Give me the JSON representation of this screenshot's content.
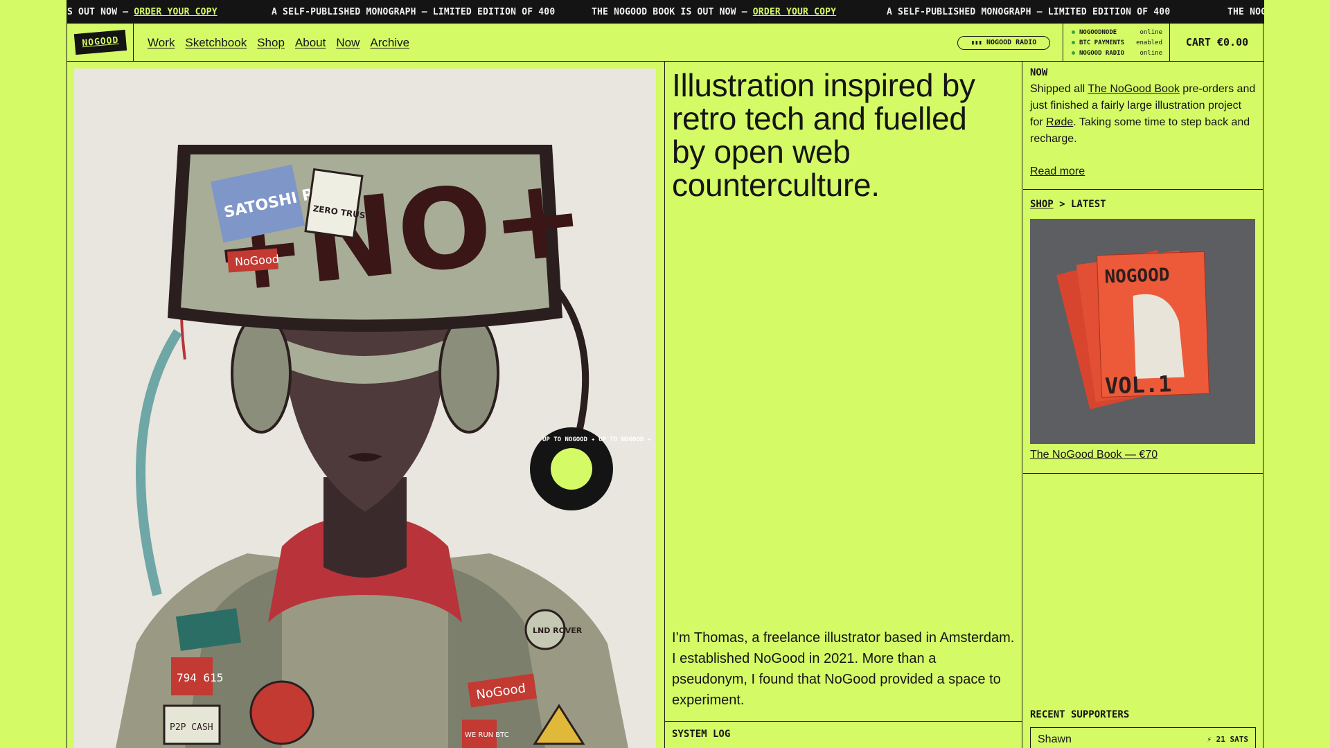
{
  "ticker": {
    "items": [
      {
        "text": "S OUT NOW — ",
        "link": "ORDER YOUR COPY"
      },
      {
        "text": "A SELF-PUBLISHED MONOGRAPH — LIMITED EDITION OF 400",
        "link": ""
      },
      {
        "text": "THE NOGOOD BOOK IS OUT NOW — ",
        "link": "ORDER YOUR COPY"
      },
      {
        "text": "A SELF-PUBLISHED MONOGRAPH — LIMITED EDITION OF 400",
        "link": ""
      },
      {
        "text": "THE NOG",
        "link": ""
      }
    ]
  },
  "header": {
    "logo": "NOGOOD",
    "nav": [
      "Work",
      "Sketchbook",
      "Shop",
      "About",
      "Now",
      "Archive"
    ],
    "radio_button": "NOGOOD RADIO",
    "status": [
      {
        "name": "NOGOODNODE",
        "state": "online"
      },
      {
        "name": "BTC PAYMENTS",
        "state": "enabled"
      },
      {
        "name": "NOGOOD RADIO",
        "state": "online"
      }
    ],
    "cart": "CART €0.00"
  },
  "hero": {
    "stickers": {
      "satoshi": "SATOSHI RADIO",
      "zero_trust": "ZERO TRUST",
      "nogood_small": "NoGood",
      "badge_ring": "UP TO NOGOOD ✦ UP TO NOGOOD ✦",
      "numbers": "794 615",
      "lnd": "LND ROVER",
      "p2p": "P2P CASH",
      "nogood_chest": "NoGood",
      "we_run": "WE RUN BTC"
    }
  },
  "main": {
    "headline": "Illustration inspired by retro tech and fuelled by open web counterculture.",
    "bio": "I’m Thomas, a freelance illustrator based in Amsterdam. I established NoGood in 2021. More than a pseudonym, I found that NoGood provided a space to experiment.",
    "system_log_label": "SYSTEM LOG"
  },
  "sidebar": {
    "now_label": "NOW",
    "now_text_1": "Shipped all ",
    "now_link_1": "The NoGood Book",
    "now_text_2": " pre-orders and just finished a fairly large illustration project for ",
    "now_link_2": "Røde",
    "now_text_3": ". Taking some time to step back and recharge.",
    "read_more": "Read more",
    "shop_link": "SHOP",
    "shop_suffix": " > LATEST",
    "product_cover_title": "NOGOOD",
    "product_cover_vol": "VOL.1",
    "product_link": "The NoGood Book — €70",
    "supporters_label": "RECENT SUPPORTERS",
    "supporters": [
      {
        "name": "Shawn",
        "amount": "⚡ 21 SATS"
      }
    ]
  },
  "colors": {
    "accent": "#d4fa66",
    "dark": "#141414",
    "red": "#c23a32"
  }
}
